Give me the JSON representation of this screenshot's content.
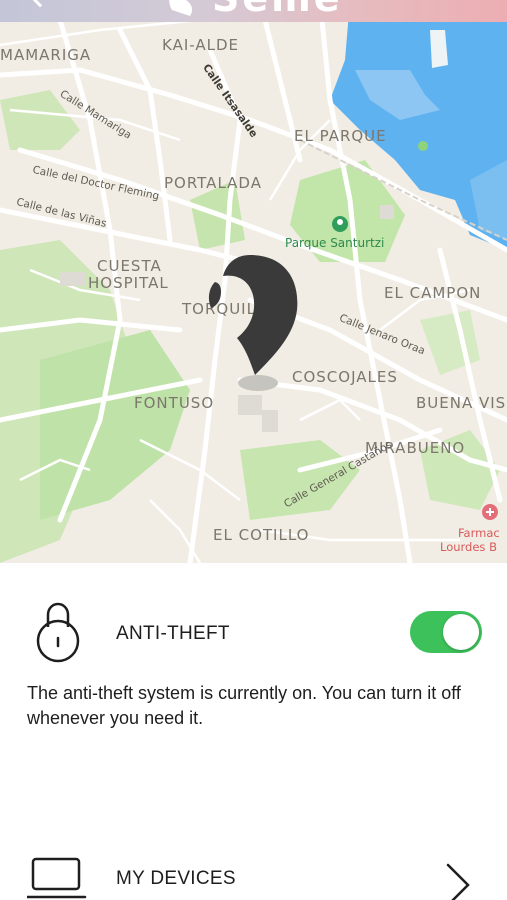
{
  "header": {
    "brand_name": "Seme",
    "back_icon": "chevron-left-icon",
    "gradient": [
      "#c3c6d8",
      "#ecaeb2"
    ]
  },
  "map": {
    "districts": {
      "mamariga": "MAMARIGA",
      "kai_alde": "KAI-ALDE",
      "el_parque": "EL PARQUE",
      "portalada": "PORTALADA",
      "cuesta_hospital_1": "CUESTA",
      "cuesta_hospital_2": "HOSPITAL",
      "torquillas": "TORQUILLAS",
      "el_campon": "EL CAMPON",
      "coscojales": "COSCOJALES",
      "fontuso": "FONTUSO",
      "buena_vista": "BUENA VIS",
      "mirabueno": "MIRABUENO",
      "el_cotillo": "EL COTILLO"
    },
    "streets": {
      "calle_mamariga": "Calle Mamariga",
      "calle_itsasalde": "Calle Itsasalde",
      "calle_doctor_fleming": "Calle del Doctor Fleming",
      "calle_vinas": "Calle de las Viñas",
      "calle_jenaro_oraa": "Calle Jenaro Oraa",
      "calle_general_castanos": "Calle General Castaños"
    },
    "pois": {
      "parque_santurtzi": "Parque Santurtzi",
      "farmacia_1": "Farmac",
      "farmacia_2": "Lourdes B"
    },
    "colors": {
      "land": "#f1ede4",
      "water": "#5fb2f0",
      "park": "#bfe2a8",
      "road": "#ffffff",
      "pin": "#3a3a3a"
    }
  },
  "anti_theft": {
    "label": "ANTI-THEFT",
    "icon": "lock-icon",
    "enabled": true,
    "toggle_color": "#3dc25b",
    "description": "The anti-theft system is currently on. You can turn it off whenever you need it."
  },
  "devices": {
    "label": "MY DEVICES",
    "icon": "laptop-icon",
    "chevron_icon": "chevron-right-icon"
  }
}
